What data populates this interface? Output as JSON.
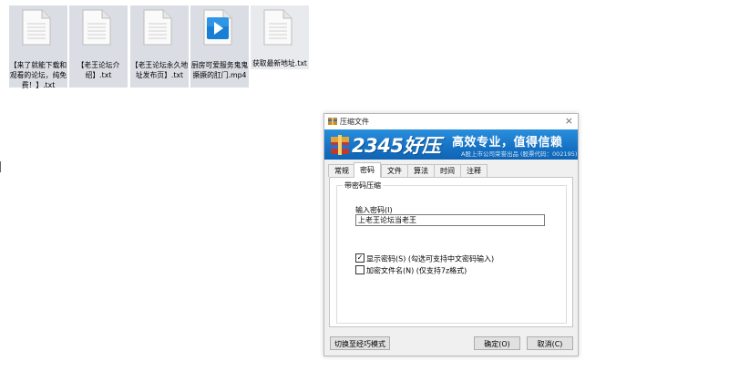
{
  "desktop": {
    "files": [
      {
        "name": "【来了就能下载和观看的论坛，纯免费！】.txt",
        "icon": "text-document-icon"
      },
      {
        "name": "【老王论坛介绍】.txt",
        "icon": "text-document-icon"
      },
      {
        "name": "【老王论坛永久地址发布页】.txt",
        "icon": "text-document-icon"
      },
      {
        "name": "厨房可爱服务鬼鬼撅撅的肛门.mp4",
        "icon": "video-file-icon"
      },
      {
        "name": "获取最新地址.txt",
        "icon": "text-document-icon"
      }
    ]
  },
  "dialog": {
    "title": "压缩文件",
    "close_glyph": "×",
    "banner": {
      "brand": "2345好压",
      "slogan": "高效专业，值得信赖",
      "sub": "A股上市公司荣誉出品 (股票代码：002195)"
    },
    "tabs": [
      "常规",
      "密码",
      "文件",
      "算法",
      "时间",
      "注释"
    ],
    "active_tab": "密码",
    "group_title": "带密码压缩",
    "password_label": "输入密码(I)",
    "password_value": "上老王论坛当老王",
    "show_password": {
      "label": "显示密码(S) (勾选可支持中文密码输入)",
      "checked": true,
      "mark": "✓"
    },
    "encrypt_names": {
      "label": "加密文件名(N) (仅支持7z格式)",
      "checked": false
    },
    "buttons": {
      "switch_mode": "切换至经巧模式",
      "ok": "确定(O)",
      "cancel": "取消(C)"
    },
    "colors": {
      "banner": "#1774c6",
      "accent": "#2a8fdd"
    }
  }
}
